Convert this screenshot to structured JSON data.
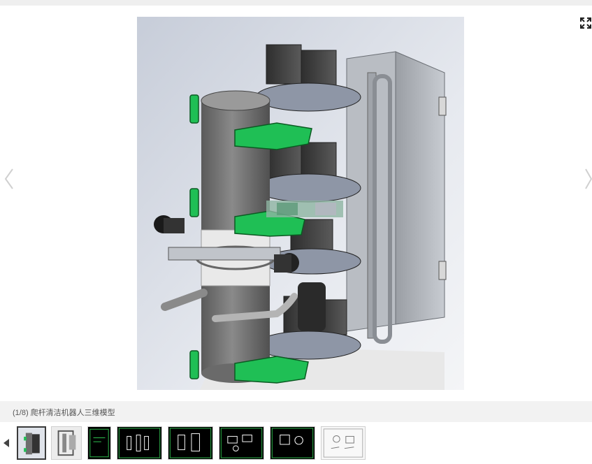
{
  "viewer": {
    "caption": "(1/8) 爬杆清洁机器人三维模型",
    "expand_icon": "expand-icon",
    "prev_icon": "chevron-left-icon",
    "next_icon": "chevron-right-icon"
  },
  "thumbnails": {
    "prev_icon": "triangle-left-icon",
    "count": 8,
    "active_index": 1
  },
  "colors": {
    "caption_bar": "#f2f2f2",
    "model_green": "#1fbf55",
    "cylinder": "#6e6e6e",
    "drawing_bg": "#000000"
  }
}
